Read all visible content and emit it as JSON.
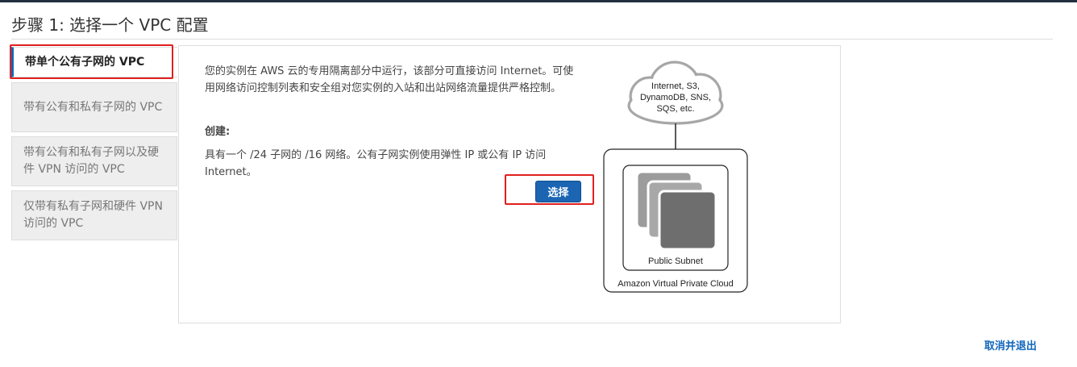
{
  "page": {
    "title": "步骤 1: 选择一个 VPC 配置"
  },
  "tabs": [
    {
      "label": "带单个公有子网的 VPC",
      "active": true
    },
    {
      "label": "带有公有和私有子网的 VPC",
      "active": false
    },
    {
      "label": "带有公有和私有子网以及硬件 VPN 访问的 VPC",
      "active": false
    },
    {
      "label": "仅带有私有子网和硬件 VPN 访问的 VPC",
      "active": false
    }
  ],
  "content": {
    "description": "您的实例在 AWS 云的专用隔离部分中运行，该部分可直接访问 Internet。可使用网络访问控制列表和安全组对您实例的入站和出站网络流量提供严格控制。",
    "create_label": "创建:",
    "create_text": "具有一个 /24 子网的 /16 网络。公有子网实例使用弹性 IP 或公有 IP 访问 Internet。",
    "select_button": "选择"
  },
  "diagram": {
    "cloud_lines": [
      "Internet, S3,",
      "DynamoDB, SNS,",
      "SQS, etc."
    ],
    "subnet_label": "Public Subnet",
    "vpc_label": "Amazon Virtual Private Cloud"
  },
  "footer": {
    "cancel_link": "取消并退出"
  },
  "colors": {
    "accent": "#1166bb",
    "highlight": "#e0201e",
    "button": "#1b65b3"
  }
}
